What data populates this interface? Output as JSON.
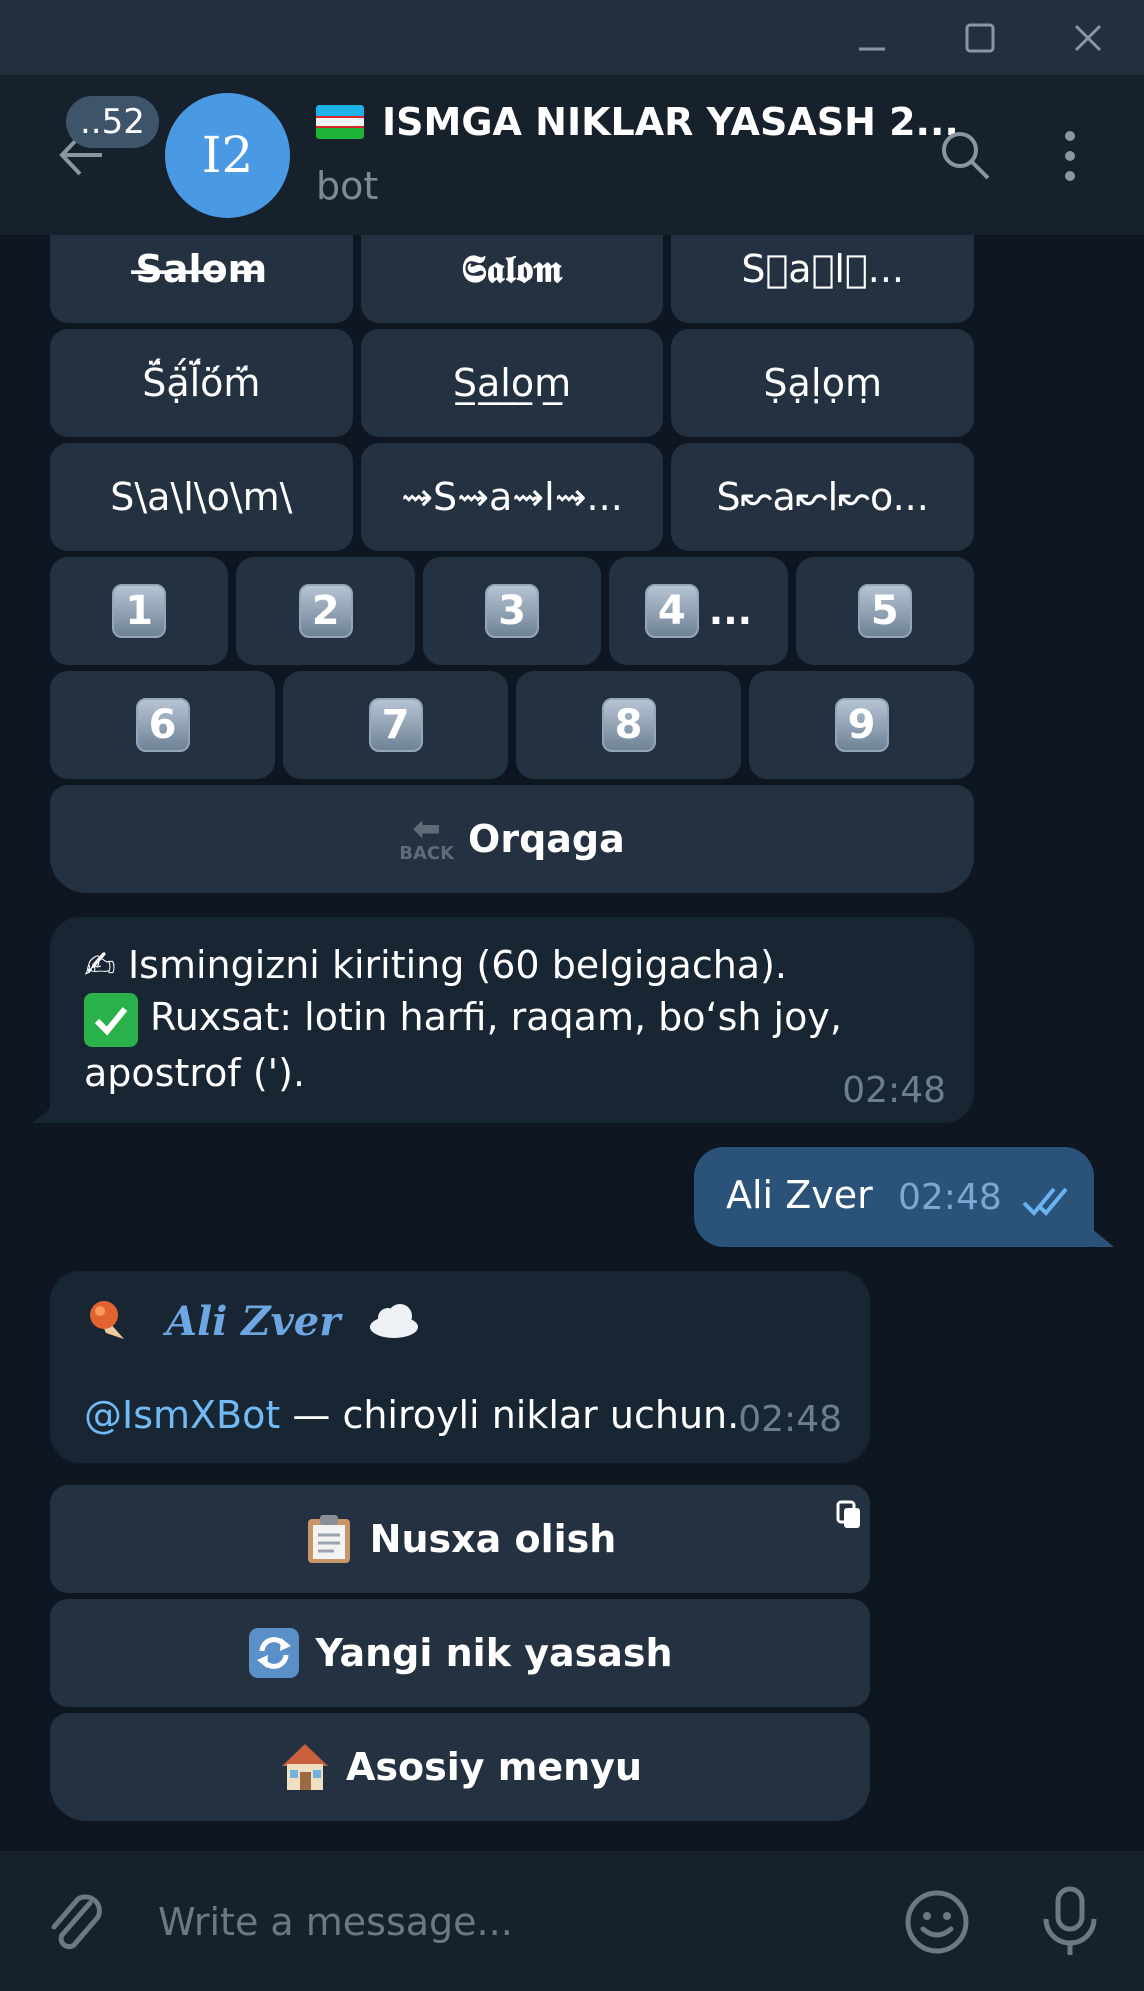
{
  "window": {
    "minimize_icon": "minimize-icon",
    "maximize_icon": "maximize-icon",
    "close_icon": "close-icon"
  },
  "header": {
    "unread_count": "..52",
    "avatar_initials": "I2",
    "title": "ISMGA NIKLAR YASASH 2...",
    "subtitle": "bot"
  },
  "keyboard_top": {
    "row1": [
      "S̶a̶l̶o̶m̶",
      "𝕾𝖆𝖑𝖔𝖒",
      "S⃝a⃝l⃝..."
    ],
    "row2": [
      "S̈́ạ̈́l̈́ö́m̈́",
      "S̲a̲l̲o̲m̲",
      "Ṣạḷọṃ"
    ],
    "row3": [
      "S\\a\\l\\o\\m\\",
      "⇝S⇝a⇝l⇝...",
      "S↜a↜l↜o..."
    ],
    "row4": [
      "1",
      "2",
      "3",
      "4",
      "5"
    ],
    "row4_suffix": "...",
    "row5": [
      "6",
      "7",
      "8",
      "9"
    ],
    "back_label": "Orqaga",
    "back_emoji_text": "BACK"
  },
  "messages": {
    "prompt_line1": "Ismingizni kiriting (60 belgigacha).",
    "prompt_line2": "Ruxsat: lotin harfi, raqam, bo‘sh joy,",
    "prompt_line3": "apostrof (').",
    "prompt_time": "02:48",
    "outgoing_text": "Ali Zver",
    "outgoing_time": "02:48",
    "result_name": "Ali  Zver",
    "result_link": "@IsmXBot",
    "result_tail": " — chiroyli niklar uchun.",
    "result_time": "02:48"
  },
  "result_buttons": {
    "copy": "Nusxa olish",
    "new": "Yangi nik yasash",
    "home": "Asosiy menyu"
  },
  "composer": {
    "placeholder": "Write a message..."
  }
}
